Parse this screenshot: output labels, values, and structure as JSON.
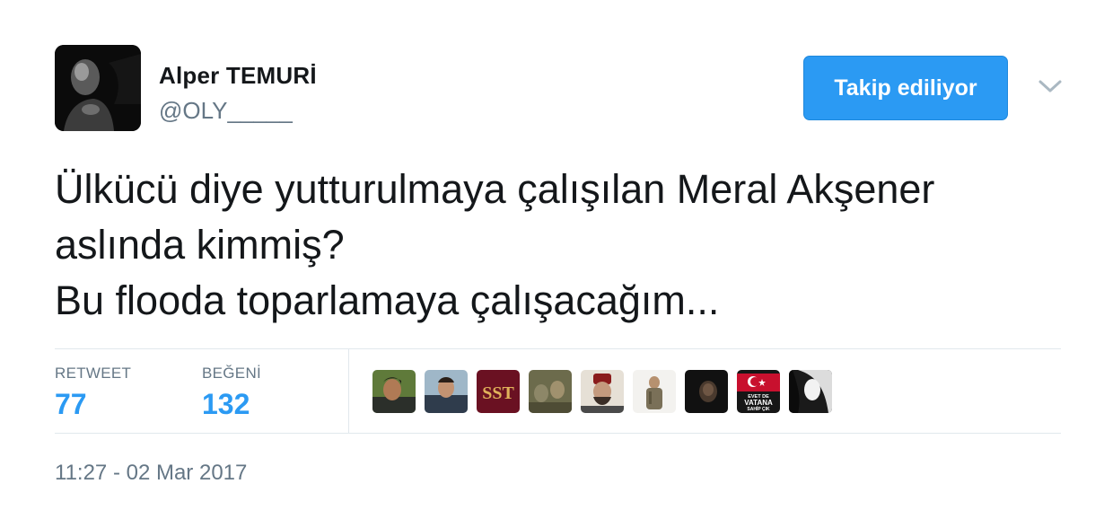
{
  "user": {
    "name": "Alper TEMURİ",
    "handle": "@OLY_____"
  },
  "follow_button": {
    "label": "Takip ediliyor"
  },
  "menu": {
    "icon": "chevron-down-icon"
  },
  "tweet": {
    "lines": [
      "Ülkücü diye yutturulmaya çalışılan Meral Akşener",
      "aslında kimmiş?",
      "Bu flooda toparlamaya çalışacağım..."
    ]
  },
  "stats": {
    "retweet_label": "RETWEET",
    "retweet_count": "77",
    "like_label": "BEĞENİ",
    "like_count": "132"
  },
  "liker_avatars": {
    "sst_text": "SST",
    "banner_lines": [
      "EVET DE",
      "VATANA",
      "SAHİP ÇIK"
    ]
  },
  "timestamp": "11:27 - 02 Mar 2017",
  "colors": {
    "accent": "#2b9af3",
    "text": "#14171a",
    "muted": "#657786",
    "divider": "#e1e8ed"
  }
}
